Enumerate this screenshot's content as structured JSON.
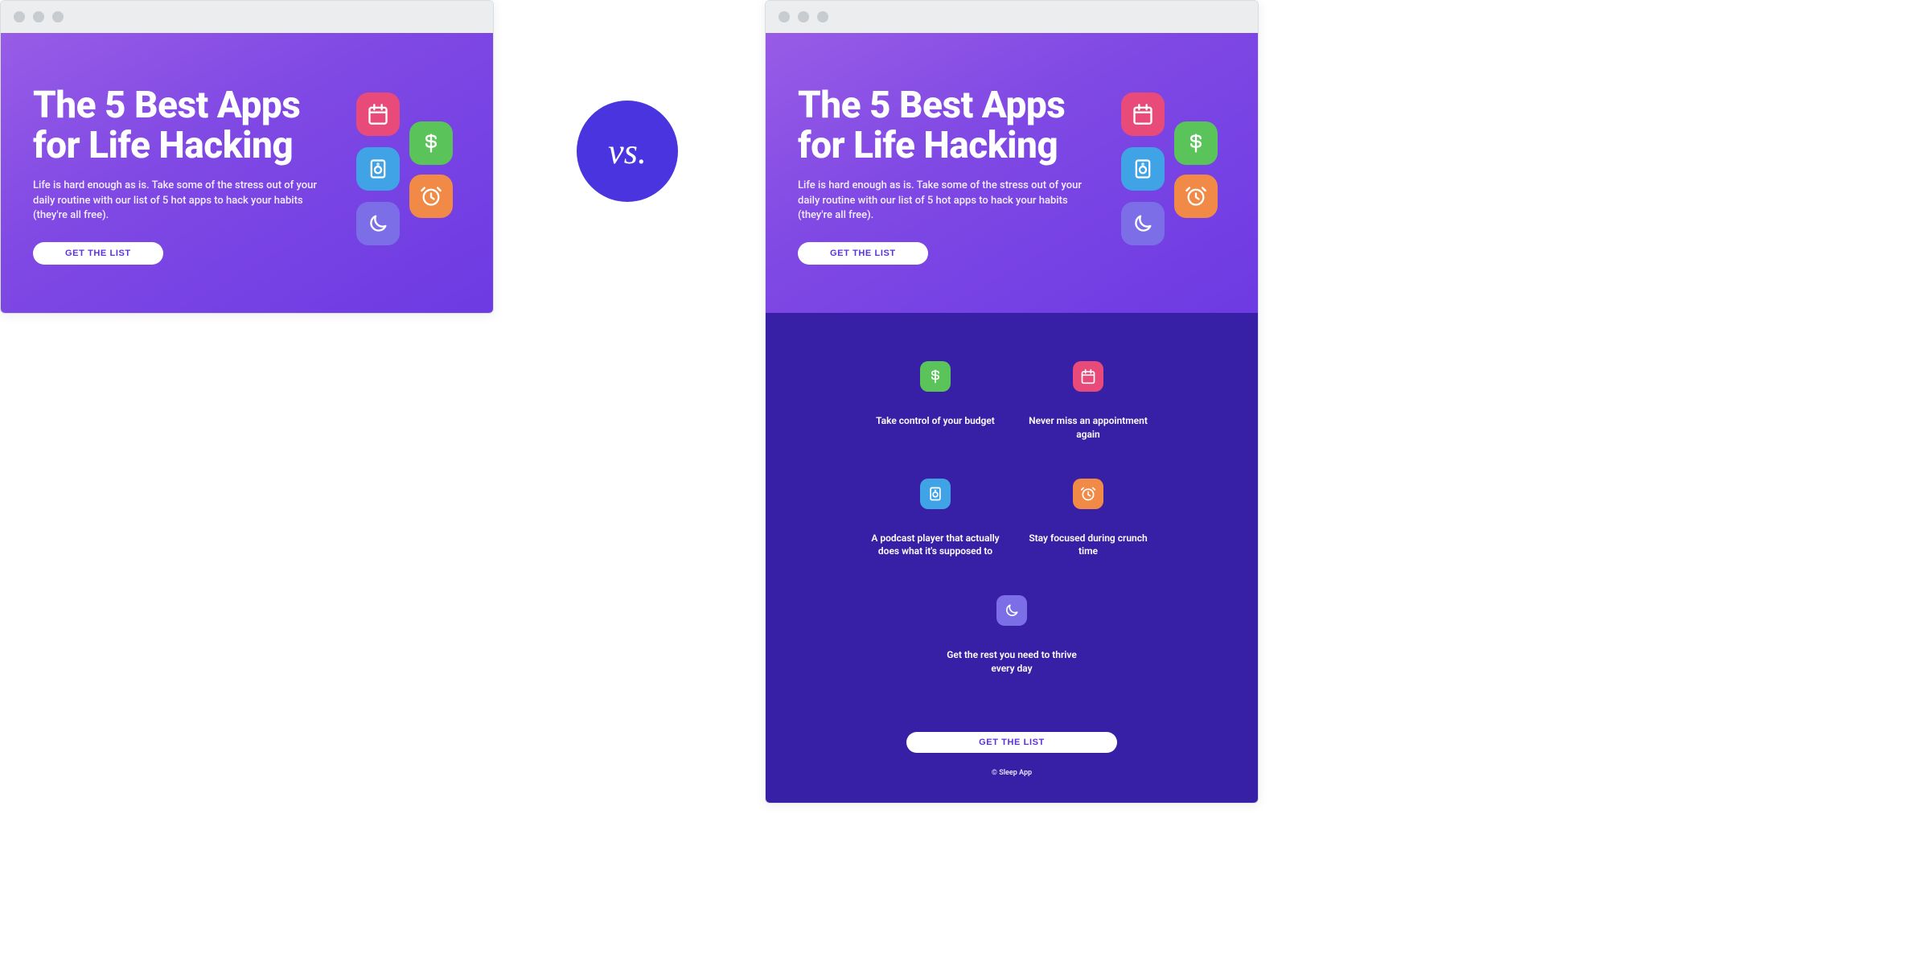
{
  "vs_label": "vs.",
  "hero": {
    "title": "The 5 Best Apps for Life Hacking",
    "subtitle": "Life is hard enough as is. Take some of the stress out of your daily routine with our list of 5 hot apps to hack your habits (they're all free).",
    "cta_label": "GET THE LIST",
    "cluster_icons": [
      "calendar",
      "dollar",
      "speaker",
      "clock",
      "moon"
    ]
  },
  "features": {
    "items": [
      {
        "icon": "dollar",
        "color": "green",
        "label": "Take control of your budget"
      },
      {
        "icon": "calendar",
        "color": "pink",
        "label": "Never miss an appointment again"
      },
      {
        "icon": "speaker",
        "color": "blue",
        "label": "A podcast player that actually does what it's supposed to"
      },
      {
        "icon": "clock",
        "color": "orange",
        "label": "Stay focused during crunch time"
      },
      {
        "icon": "moon",
        "color": "indigo",
        "label": "Get the rest you need to thrive every day"
      }
    ],
    "cta_label": "GET THE LIST",
    "copyright": "© Sleep App"
  },
  "icon_colors": {
    "pink": "#e84a79",
    "green": "#5ac35a",
    "blue": "#3fa3e6",
    "orange": "#f18a46",
    "indigo": "#7b6ee7"
  }
}
